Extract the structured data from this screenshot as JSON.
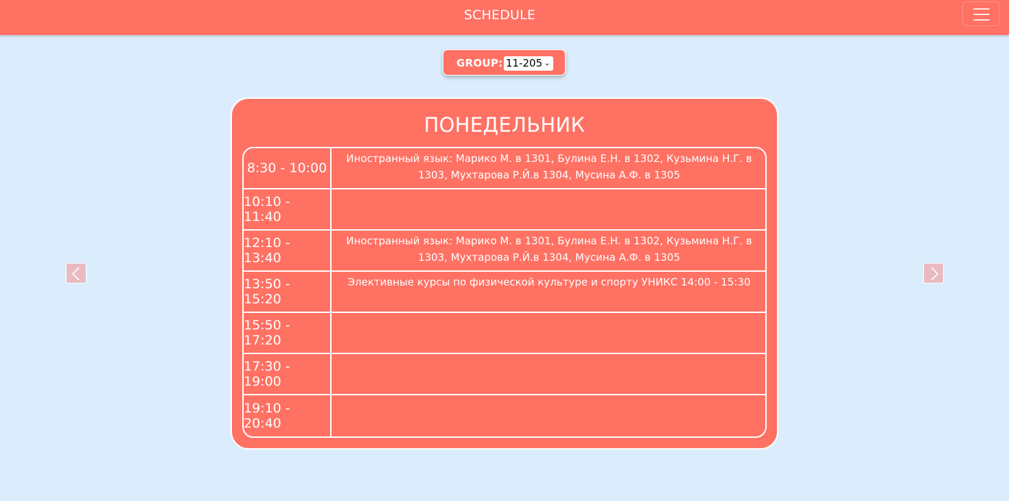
{
  "header": {
    "title": "SCHEDULE",
    "menu_icon": "hamburger-menu-icon"
  },
  "group_selector": {
    "label": "GROUP:",
    "selected": "11-205",
    "chevron_icon": "chevron-down-icon"
  },
  "day": {
    "name": "ПОНЕДЕЛЬНИК",
    "lessons": [
      {
        "time": "8:30 - 10:00",
        "subject": "Иностранный язык: Марико М. в 1301, Булина Е.Н. в 1302, Кузьмина Н.Г. в 1303, Мухтарова Р.Й.в 1304, Мусина А.Ф. в 1305"
      },
      {
        "time": "10:10 - 11:40",
        "subject": ""
      },
      {
        "time": "12:10 - 13:40",
        "subject": "Иностранный язык: Марико М. в 1301, Булина Е.Н. в 1302, Кузьмина Н.Г. в 1303, Мухтарова Р.Й.в 1304, Мусина А.Ф. в 1305"
      },
      {
        "time": "13:50 - 15:20",
        "subject": "Элективные курсы по физической культуре и спорту УНИКС 14:00 - 15:30"
      },
      {
        "time": "15:50 - 17:20",
        "subject": ""
      },
      {
        "time": "17:30 - 19:00",
        "subject": ""
      },
      {
        "time": "19:10 - 20:40",
        "subject": ""
      }
    ]
  },
  "navigation": {
    "prev_icon": "chevron-left-icon",
    "next_icon": "chevron-right-icon"
  },
  "colors": {
    "accent": "#ff7163",
    "background": "#dbedfd",
    "text": "#ffffff"
  }
}
